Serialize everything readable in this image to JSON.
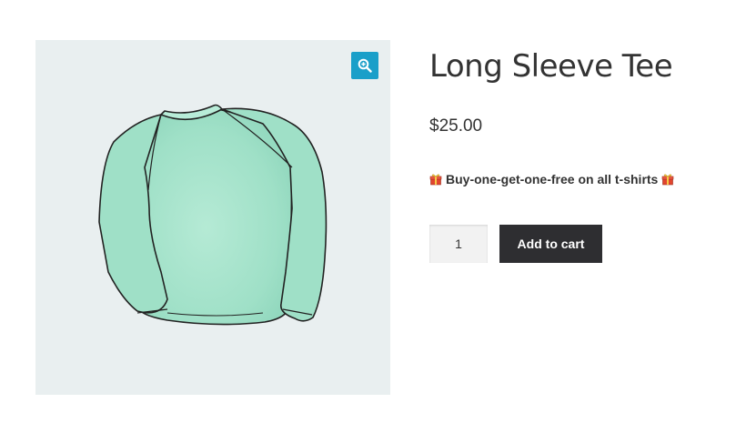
{
  "product": {
    "title": "Long Sleeve Tee",
    "price": "$25.00",
    "promo_text": "Buy-one-get-one-free on all t-shirts",
    "quantity": "1",
    "add_to_cart_label": "Add to cart"
  },
  "icons": {
    "zoom": "zoom-in-icon",
    "promo": "gift-icon"
  },
  "colors": {
    "zoom_button": "#1a9fc9",
    "add_to_cart_button": "#2e2e31",
    "gallery_background": "#e9eff0",
    "shirt": "#9fe0c8"
  }
}
